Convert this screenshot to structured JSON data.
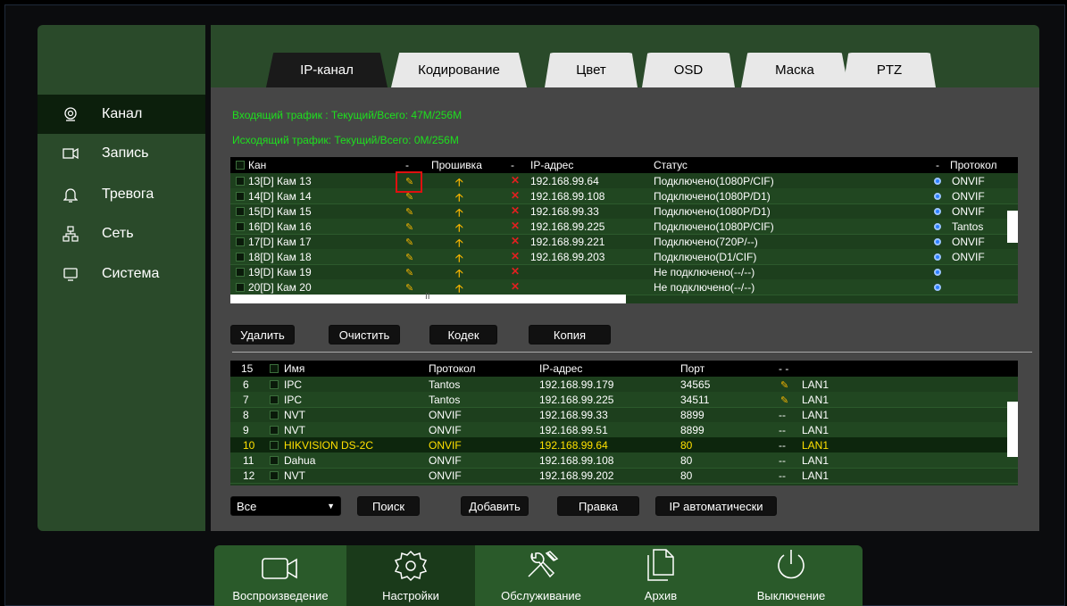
{
  "sidebar": {
    "items": [
      {
        "label": "Канал",
        "icon": "camera-lens-icon",
        "active": true
      },
      {
        "label": "Запись",
        "icon": "video-recorder-icon",
        "active": false
      },
      {
        "label": "Тревога",
        "icon": "bell-icon",
        "active": false
      },
      {
        "label": "Сеть",
        "icon": "network-icon",
        "active": false
      },
      {
        "label": "Система",
        "icon": "monitor-icon",
        "active": false
      }
    ]
  },
  "tabs": [
    {
      "label": "IP-канал",
      "active": true
    },
    {
      "label": "Кодирование",
      "active": false
    },
    {
      "label": "Цвет",
      "active": false
    },
    {
      "label": "OSD",
      "active": false
    },
    {
      "label": "Маска",
      "active": false
    },
    {
      "label": "PTZ",
      "active": false
    }
  ],
  "traffic": {
    "incoming": "Входящий трафик : Текущий/Всего: 47M/256M",
    "outgoing": "Исходящий трафик: Текущий/Всего: 0M/256M"
  },
  "channels": {
    "headers": [
      "Кан",
      "-",
      "Прошивка",
      "-",
      "IP-адрес",
      "Статус",
      "-",
      "Протокол"
    ],
    "rows": [
      {
        "name": "13[D] Кам 13",
        "ip": "192.168.99.64",
        "status": "Подключено(1080P/CIF)",
        "protocol": "ONVIF"
      },
      {
        "name": "14[D] Кам 14",
        "ip": "192.168.99.108",
        "status": "Подключено(1080P/D1)",
        "protocol": "ONVIF"
      },
      {
        "name": "15[D] Кам 15",
        "ip": "192.168.99.33",
        "status": "Подключено(1080P/D1)",
        "protocol": "ONVIF"
      },
      {
        "name": "16[D] Кам 16",
        "ip": "192.168.99.225",
        "status": "Подключено(1080P/CIF)",
        "protocol": "Tantos"
      },
      {
        "name": "17[D] Кам 17",
        "ip": "192.168.99.221",
        "status": "Подключено(720P/--)",
        "protocol": "ONVIF"
      },
      {
        "name": "18[D] Кам 18",
        "ip": "192.168.99.203",
        "status": "Подключено(D1/CIF)",
        "protocol": "ONVIF"
      },
      {
        "name": "19[D] Кам 19",
        "ip": "",
        "status": "Не подключено(--/--)",
        "protocol": ""
      },
      {
        "name": "20[D] Кам 20",
        "ip": "",
        "status": "Не подключено(--/--)",
        "protocol": ""
      }
    ],
    "hscroll_mark": "II"
  },
  "channel_buttons": {
    "delete": "Удалить",
    "clear": "Очистить",
    "codec": "Кодек",
    "copy": "Копия"
  },
  "devices": {
    "count": "15",
    "headers": [
      "Имя",
      "Протокол",
      "IP-адрес",
      "Порт",
      "- -"
    ],
    "rows": [
      {
        "num": "6",
        "name": "IPC",
        "protocol": "Tantos",
        "ip": "192.168.99.179",
        "port": "34565",
        "edit": "pencil",
        "lan": "LAN1",
        "selected": false
      },
      {
        "num": "7",
        "name": "IPC",
        "protocol": "Tantos",
        "ip": "192.168.99.225",
        "port": "34511",
        "edit": "pencil",
        "lan": "LAN1",
        "selected": false
      },
      {
        "num": "8",
        "name": "NVT",
        "protocol": "ONVIF",
        "ip": "192.168.99.33",
        "port": "8899",
        "edit": "--",
        "lan": "LAN1",
        "selected": false
      },
      {
        "num": "9",
        "name": "NVT",
        "protocol": "ONVIF",
        "ip": "192.168.99.51",
        "port": "8899",
        "edit": "--",
        "lan": "LAN1",
        "selected": false
      },
      {
        "num": "10",
        "name": "HIKVISION DS-2C",
        "protocol": "ONVIF",
        "ip": "192.168.99.64",
        "port": "80",
        "edit": "--",
        "lan": "LAN1",
        "selected": true
      },
      {
        "num": "11",
        "name": "Dahua",
        "protocol": "ONVIF",
        "ip": "192.168.99.108",
        "port": "80",
        "edit": "--",
        "lan": "LAN1",
        "selected": false
      },
      {
        "num": "12",
        "name": "NVT",
        "protocol": "ONVIF",
        "ip": "192.168.99.202",
        "port": "80",
        "edit": "--",
        "lan": "LAN1",
        "selected": false
      }
    ]
  },
  "device_buttons": {
    "filter_value": "Все",
    "search": "Поиск",
    "add": "Добавить",
    "edit": "Правка",
    "auto_ip": "IP автоматически"
  },
  "bottom_bar": [
    {
      "label": "Воспроизведение",
      "icon": "playback-camera-icon",
      "active": false
    },
    {
      "label": "Настройки",
      "icon": "settings-gear-icon",
      "active": true
    },
    {
      "label": "Обслуживание",
      "icon": "maintenance-tools-icon",
      "active": false
    },
    {
      "label": "Архив",
      "icon": "archive-files-icon",
      "active": false
    },
    {
      "label": "Выключение",
      "icon": "power-icon",
      "active": false
    }
  ],
  "colors": {
    "panel_green": "#2a4a2a",
    "traffic_text": "#1ee01e",
    "selected_row_text": "#ffe000",
    "highlight_box": "#e01010"
  }
}
